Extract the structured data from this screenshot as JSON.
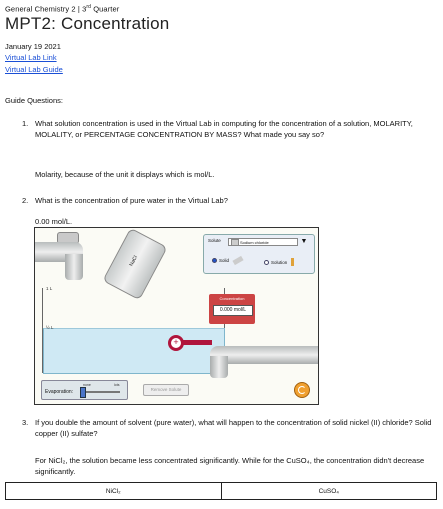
{
  "header": {
    "course_prefix": "General Chemistry 2 | 3",
    "course_sup": "rd",
    "course_suffix": " Quarter",
    "title": "MPT2: Concentration",
    "date": "January 19  2021",
    "link1": "Virtual Lab Link",
    "link2": "Virtual Lab Guide"
  },
  "guide_label": "Guide Questions:",
  "q1": {
    "num": "1.",
    "text": "What solution concentration is used in the Virtual Lab in computing for the concentration of a solution, MOLARITY, MOLALITY, or PERCENTAGE CONCENTRATION BY MASS? What made you say so?",
    "answer": "Molarity, because of the unit it displays which is mol/L."
  },
  "q2": {
    "num": "2.",
    "text": "What is the concentration of pure water in the Virtual Lab?",
    "answer": "0.00 mol/L."
  },
  "sim": {
    "solute_label": "Solute",
    "solute_value": "Sodium chloride",
    "solid_label": "Solid",
    "solution_label": "Solution",
    "shaker_label": "NaCl",
    "tick_1l": "1 L",
    "tick_half": "½ L",
    "meter_label": "Concentration",
    "meter_value": "0.000 mol/L",
    "evap_label": "Evaporation:",
    "evap_none": "none",
    "evap_lots": "lots",
    "remove_label": "Remove Solute"
  },
  "q3": {
    "num": "3.",
    "text": "If you double the amount of solvent (pure water), what will happen to the concentration of solid nickel (II) chloride? Solid copper (II) sulfate?",
    "answer": "For NiCl₂, the solution became less concentrated significantly. While for the CuSO₄, the concentration didn't decrease significantly."
  },
  "table": {
    "col1": "NiCl₂",
    "col2": "CuSO₄"
  }
}
